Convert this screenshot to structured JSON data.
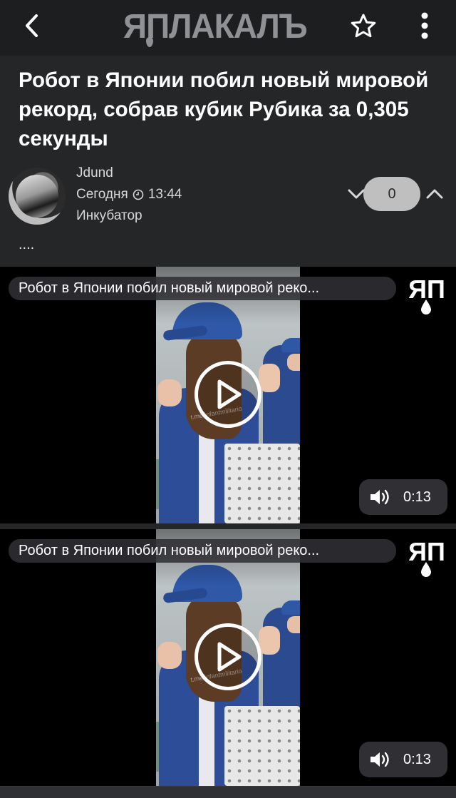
{
  "header": {
    "logo_text": "ЯПЛАКАЛЪ",
    "back_icon": "chevron-left-icon",
    "favorite_icon": "star-outline-icon",
    "menu_icon": "more-vertical-icon"
  },
  "post": {
    "title": "Робот в Японии побил новый мировой рекорд, собрав кубик Рубика за 0,305 секунды",
    "author": "Jdund",
    "date": "Сегодня",
    "time": "13:44",
    "community": "Инкубатор",
    "rating": "0",
    "text": "...."
  },
  "videos": [
    {
      "title": "Робот в Японии побил новый мировой реко...",
      "logo_text": "ЯП",
      "duration": "0:13",
      "watermark": "t.me/infantmilitario"
    },
    {
      "title": "Робот в Японии побил новый мировой реко...",
      "logo_text": "ЯП",
      "duration": "0:13",
      "watermark": "t.me/infantmilitario"
    }
  ],
  "colors": {
    "background": "#252628",
    "topbar": "#1d1e20",
    "logo": "#8f9194",
    "vote_pill": "#bfbfbf"
  }
}
